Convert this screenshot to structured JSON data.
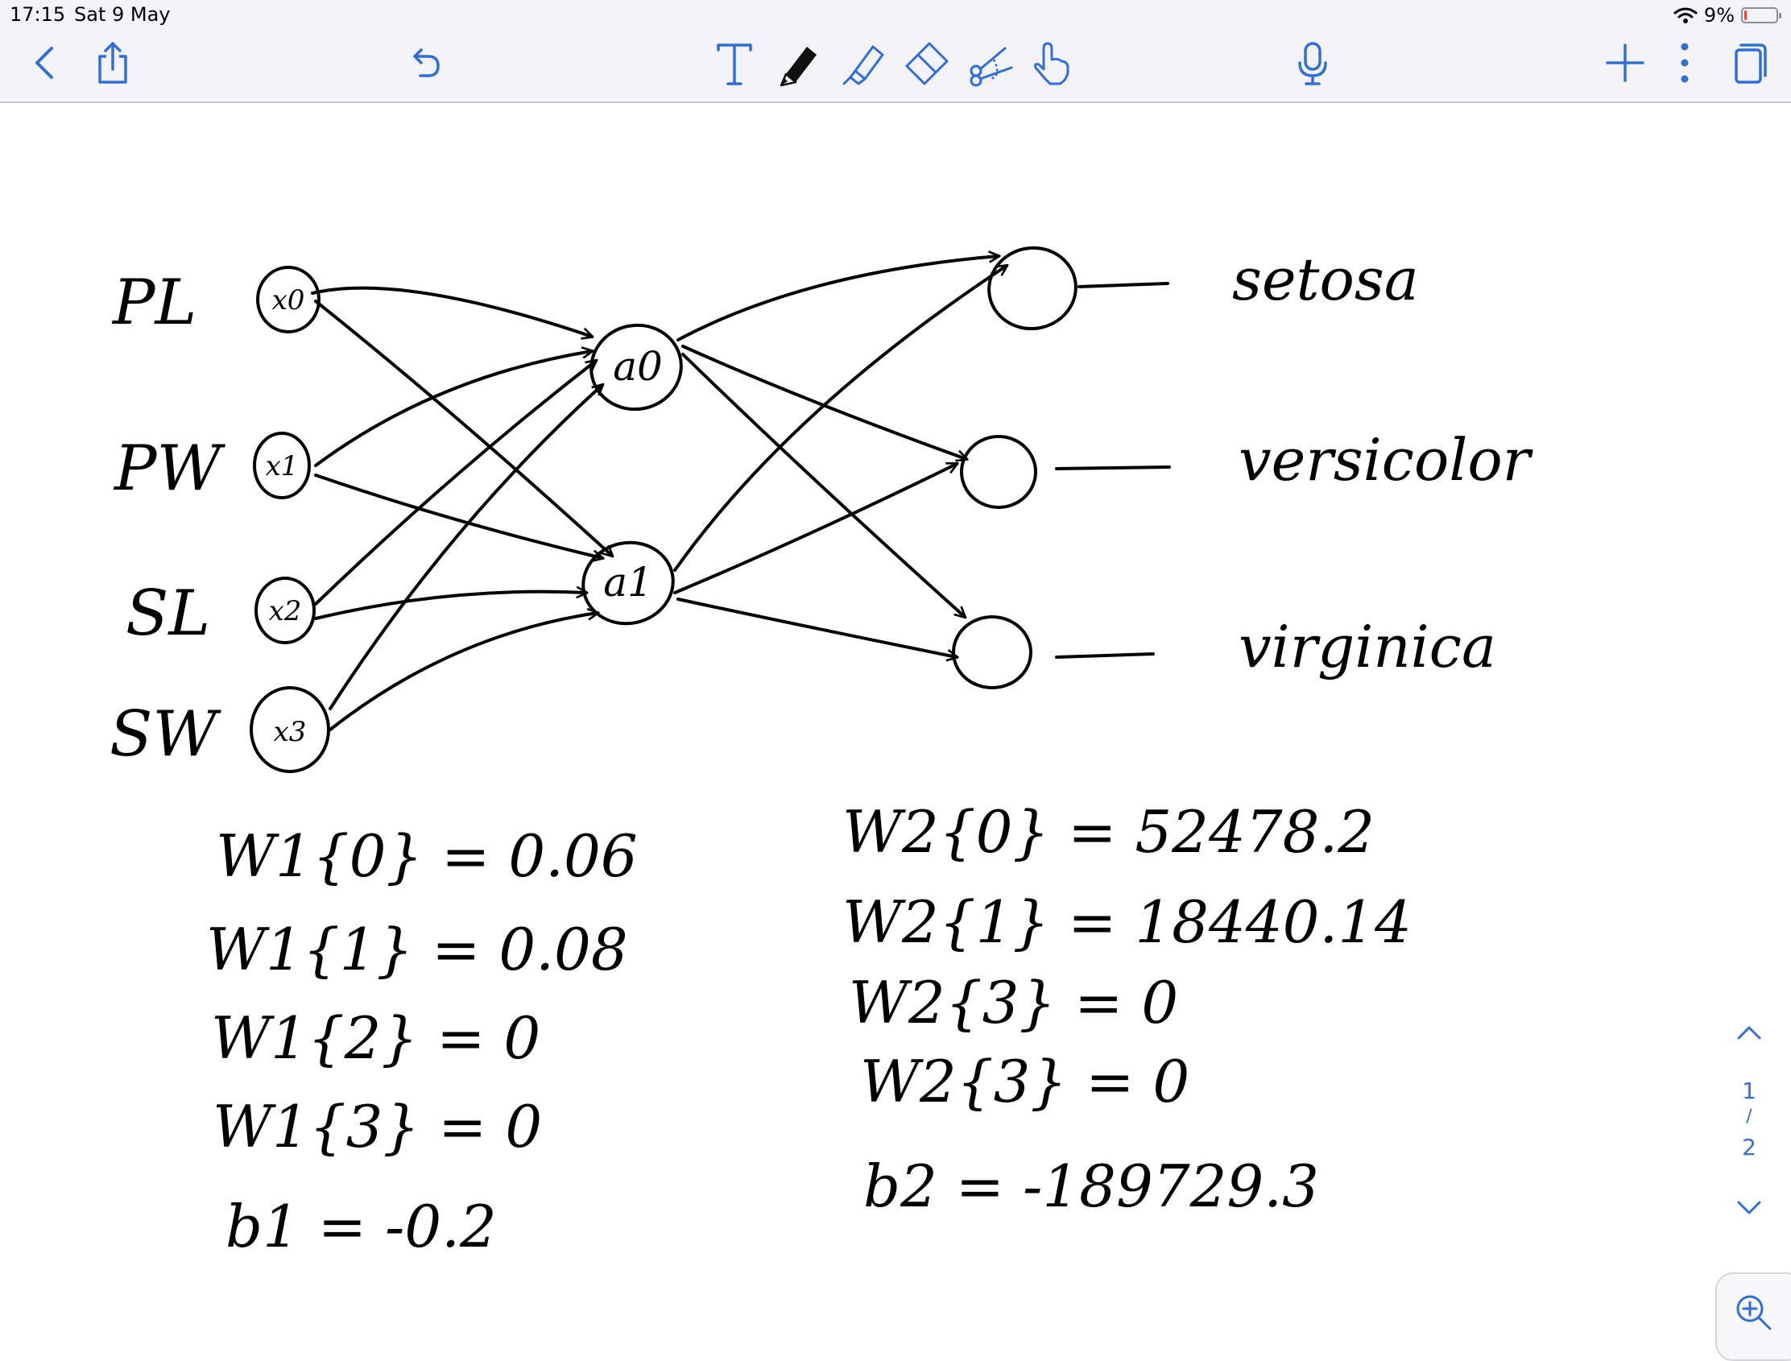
{
  "status_bar": {
    "time": "17:15",
    "date": "Sat 9 May",
    "battery": "9%",
    "battery_level": 0.09
  },
  "toolbar": {
    "left_icons": [
      "back-chevron-icon",
      "share-icon",
      "undo-icon"
    ],
    "tools": [
      "text-tool-icon",
      "pen-icon",
      "highlighter-icon",
      "eraser-icon",
      "lasso-scissors-icon",
      "hand-pointer-icon",
      "microphone-icon"
    ],
    "right_icons": [
      "add-icon",
      "more-icon",
      "page-view-icon"
    ],
    "icon_color": "#2f6fd6"
  },
  "notes": {
    "input_labels": [
      "PL",
      "PW",
      "SL",
      "SW"
    ],
    "input_nodes": [
      "x0",
      "x1",
      "x2",
      "x3"
    ],
    "hidden_nodes": [
      "a0",
      "a1"
    ],
    "output_labels": [
      "setosa",
      "versicolor",
      "virginica"
    ],
    "w1": [
      "W1{0} = 0.06",
      "W1{1} = 0.08",
      "W1{2} = 0",
      "W1{3} = 0",
      "b1 = -0.2"
    ],
    "w2": [
      "W2{0} = 52478.2",
      "W2{1} = 18440.14",
      "W2{3} = 0",
      "W2{3} = 0",
      "b2 = -189729.3"
    ]
  },
  "page_nav": {
    "current": "1",
    "separator": "/",
    "total": "2"
  }
}
